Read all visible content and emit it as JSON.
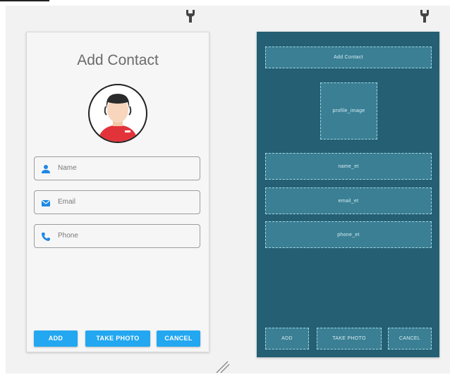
{
  "design": {
    "title": "Add Contact",
    "fields": [
      {
        "label": "Name",
        "icon": "person-icon"
      },
      {
        "label": "Email",
        "icon": "mail-icon"
      },
      {
        "label": "Phone",
        "icon": "phone-icon"
      }
    ],
    "buttons": {
      "add": "ADD",
      "take_photo": "TAKE PHOTO",
      "cancel": "CANCEL"
    }
  },
  "blueprint": {
    "title": "Add Contact",
    "profile_image": "profile_image",
    "name": "name_et",
    "email": "email_et",
    "phone": "phone_et",
    "buttons": {
      "add": "ADD",
      "take_photo": "TAKE PHOTO",
      "cancel": "CANCEL"
    }
  },
  "colors": {
    "accent": "#22a7f0",
    "blueprint_bg": "#245f74",
    "blueprint_box": "#3a7f94"
  }
}
